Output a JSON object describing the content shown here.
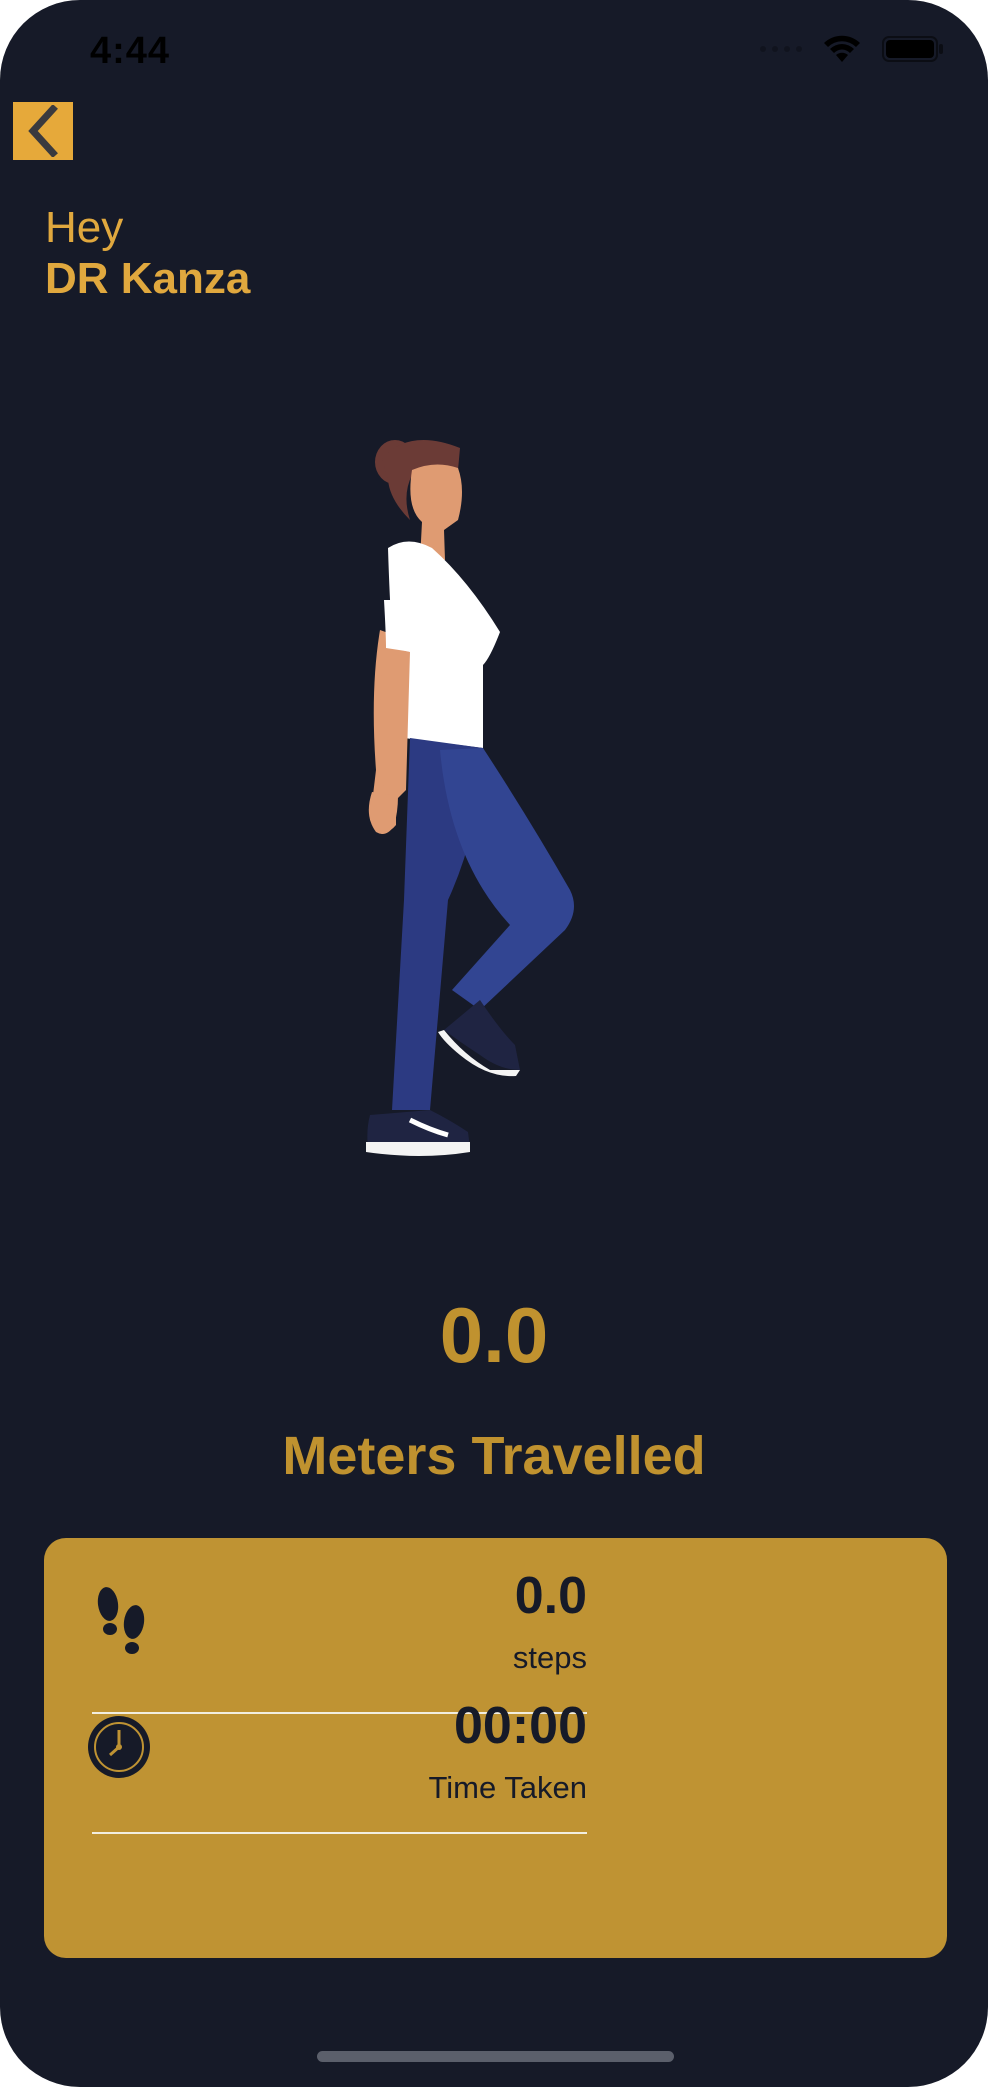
{
  "status_bar": {
    "time": "4:44"
  },
  "header": {
    "back_icon": "chevron-left-icon",
    "greeting": "Hey",
    "user_name": "DR Kanza"
  },
  "distance": {
    "value": "0.0",
    "label": "Meters Travelled"
  },
  "stats": {
    "steps": {
      "icon": "footprints-icon",
      "value": "0.0",
      "label": "steps"
    },
    "time": {
      "icon": "clock-icon",
      "value": "00:00",
      "label": "Time Taken"
    }
  },
  "colors": {
    "background": "#161a28",
    "accent": "#c0922f",
    "card": "#bf9333",
    "back_button": "#e6a93a"
  }
}
